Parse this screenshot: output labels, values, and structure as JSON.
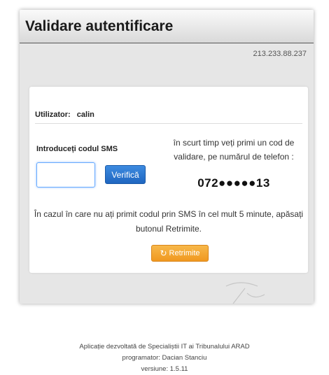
{
  "panel": {
    "title": "Validare autentificare",
    "ip": "213.233.88.237"
  },
  "user": {
    "label": "Utilizator:",
    "value": "calin"
  },
  "sms": {
    "label": "Introduceți codul SMS",
    "input_value": "",
    "input_placeholder": "",
    "verify_label": "Verifică"
  },
  "info": {
    "text": "în scurt timp veți primi un cod de validare, pe numărul de telefon :",
    "phone": "072●●●●●13"
  },
  "notice": {
    "text": "În cazul în care nu ați primit codul prin SMS în cel mult 5 minute, apăsați butonul Retrimite."
  },
  "resend": {
    "icon": "refresh-icon",
    "label": "Retrimite"
  },
  "footer": {
    "line1": "Aplicație dezvoltată de Specialiștii IT ai Tribunalului ARAD",
    "line2": "programator: Dacian Stanciu",
    "line3": "versiune: 1.5.11"
  },
  "colors": {
    "verify_button": "#2a74d0",
    "resend_button": "#f0a030",
    "panel_background": "#e6e6e6",
    "input_focus": "#66aaff"
  }
}
